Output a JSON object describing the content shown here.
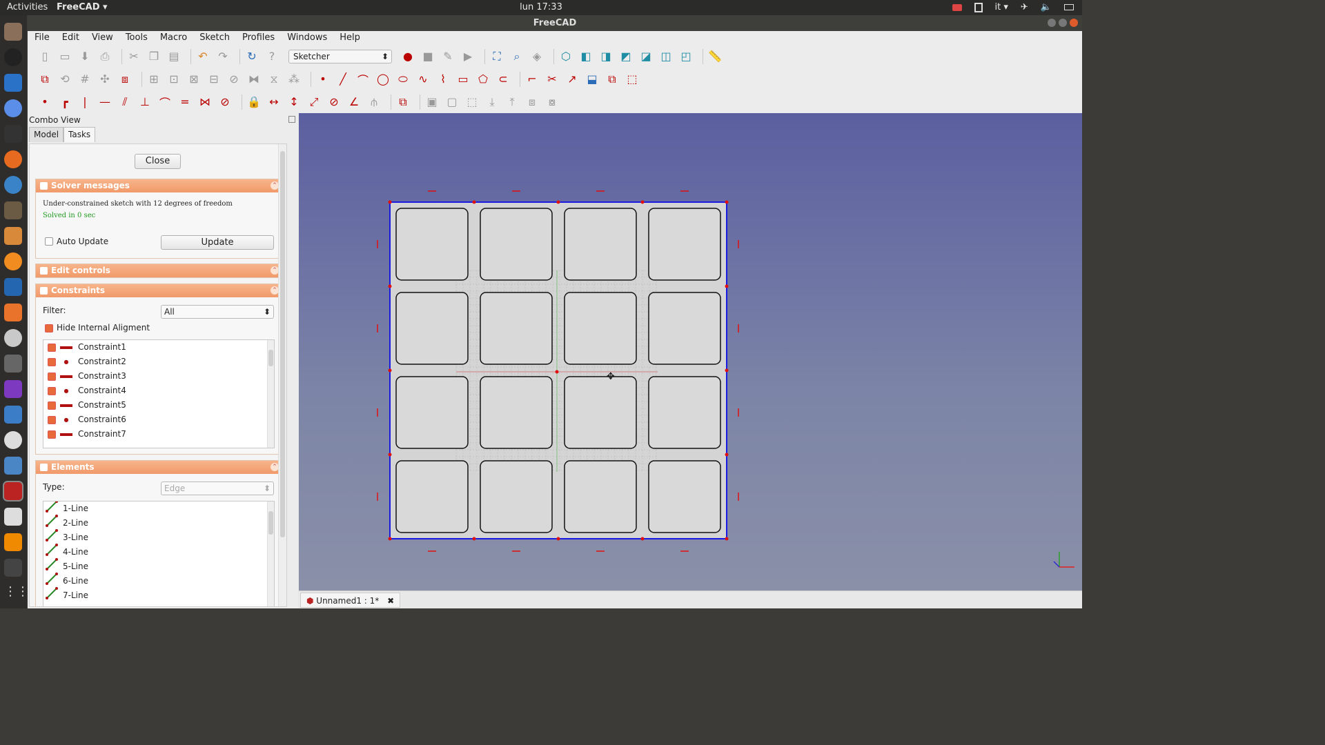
{
  "topbar": {
    "activities": "Activities",
    "app_name": "FreeCAD ▾",
    "clock": "lun 17:33",
    "lang": "it ▾"
  },
  "window": {
    "title": "FreeCAD"
  },
  "menu": [
    "File",
    "Edit",
    "View",
    "Tools",
    "Macro",
    "Sketch",
    "Profiles",
    "Windows",
    "Help"
  ],
  "toolbar": {
    "workbench": "Sketcher"
  },
  "combo": {
    "title": "Combo View",
    "tabs": {
      "model": "Model",
      "tasks": "Tasks"
    },
    "close_label": "Close",
    "solver": {
      "title": "Solver messages",
      "message": "Under-constrained sketch with 12 degrees of freedom",
      "solved": "Solved in 0 sec",
      "auto_update": "Auto Update",
      "update_label": "Update"
    },
    "edit_controls": {
      "title": "Edit controls"
    },
    "constraints": {
      "title": "Constraints",
      "filter_label": "Filter:",
      "filter_value": "All",
      "hide_internal": "Hide Internal Aligment",
      "items": [
        {
          "name": "Constraint1",
          "kind": "line"
        },
        {
          "name": "Constraint2",
          "kind": "point"
        },
        {
          "name": "Constraint3",
          "kind": "line"
        },
        {
          "name": "Constraint4",
          "kind": "point"
        },
        {
          "name": "Constraint5",
          "kind": "line"
        },
        {
          "name": "Constraint6",
          "kind": "point"
        },
        {
          "name": "Constraint7",
          "kind": "line"
        }
      ]
    },
    "elements": {
      "title": "Elements",
      "type_label": "Type:",
      "type_value": "Edge",
      "items": [
        "1-Line",
        "2-Line",
        "3-Line",
        "4-Line",
        "5-Line",
        "6-Line",
        "7-Line"
      ]
    }
  },
  "document_tab": {
    "label": "Unnamed1 : 1*"
  },
  "colors": {
    "sketch_border": "#1a1ae0",
    "vertex": "#e01010",
    "panel_header": "#f19a6a",
    "viewport_top": "#5b5fa0"
  }
}
